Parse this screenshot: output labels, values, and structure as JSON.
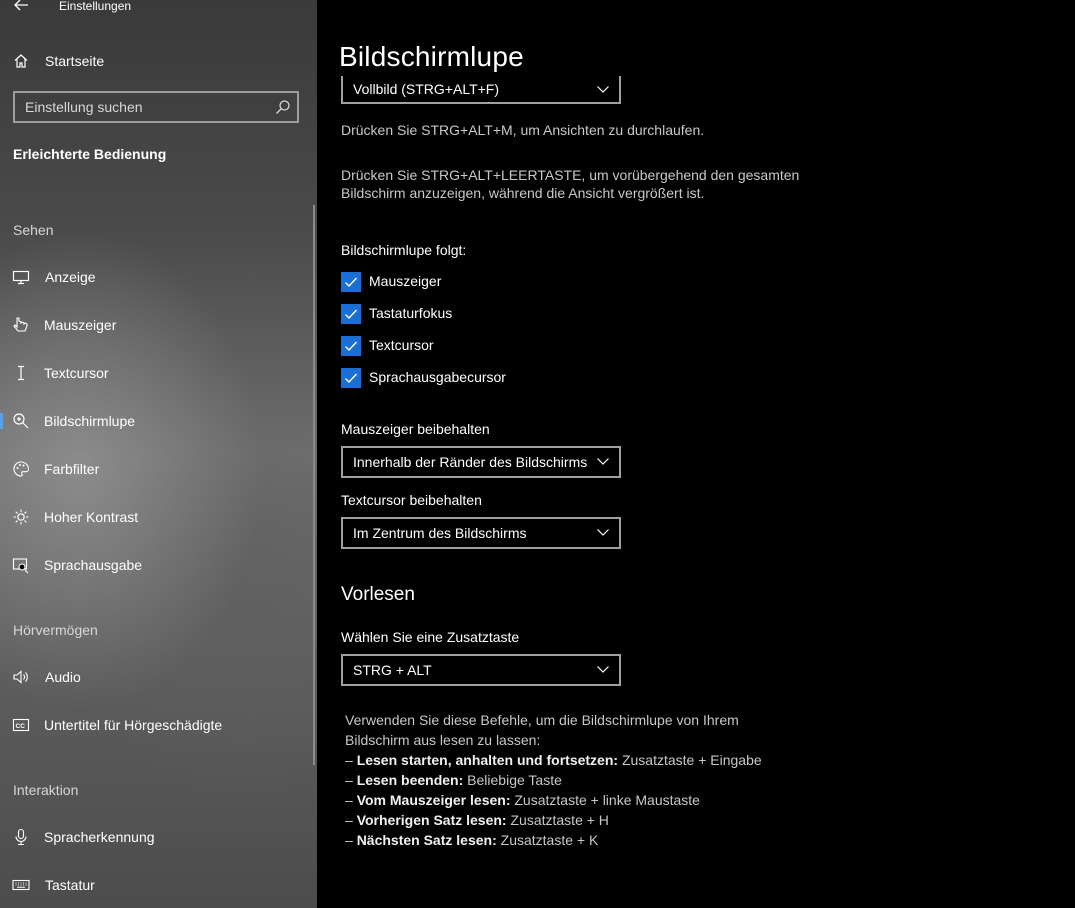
{
  "window": {
    "app_title": "Einstellungen",
    "icons": {
      "back": "back-arrow-icon"
    }
  },
  "sidebar": {
    "home": {
      "label": "Startseite",
      "icon": "home-icon"
    },
    "search": {
      "placeholder": "Einstellung suchen",
      "value": "",
      "icon": "search-icon"
    },
    "group_title": "Erleichterte Bedienung",
    "sections": {
      "sehen": "Sehen",
      "hoeren": "Hörvermögen",
      "interaktion": "Interaktion"
    },
    "items": [
      {
        "id": "anzeige",
        "label": "Anzeige",
        "icon": "display-icon"
      },
      {
        "id": "mauszeiger",
        "label": "Mauszeiger",
        "icon": "mouse-pointer-icon"
      },
      {
        "id": "textcursor",
        "label": "Textcursor",
        "icon": "text-cursor-icon"
      },
      {
        "id": "bildschirmlupe",
        "label": "Bildschirmlupe",
        "icon": "magnifier-icon",
        "active": true
      },
      {
        "id": "farbfilter",
        "label": "Farbfilter",
        "icon": "palette-icon"
      },
      {
        "id": "kontrast",
        "label": "Hoher Kontrast",
        "icon": "sun-icon"
      },
      {
        "id": "sprachausgabe",
        "label": "Sprachausgabe",
        "icon": "narrator-icon"
      },
      {
        "id": "audio",
        "label": "Audio",
        "icon": "speaker-icon"
      },
      {
        "id": "untertitel",
        "label": "Untertitel für Hörgeschädigte",
        "icon": "closed-captions-icon"
      },
      {
        "id": "spracherkennung",
        "label": "Spracherkennung",
        "icon": "microphone-icon"
      },
      {
        "id": "tastatur",
        "label": "Tastatur",
        "icon": "keyboard-icon"
      }
    ],
    "active_color": "#5aa0e6"
  },
  "main": {
    "title": "Bildschirmlupe",
    "view_dropdown": {
      "value": "Vollbild (STRG+ALT+F)"
    },
    "hint_cycle": "Drücken Sie STRG+ALT+M, um Ansichten zu durchlaufen.",
    "hint_full_1": "Drücken Sie STRG+ALT+LEERTASTE, um vorübergehend den gesamten",
    "hint_full_2": "Bildschirm anzuzeigen, während die Ansicht vergrößert ist.",
    "follows_label": "Bildschirmlupe folgt:",
    "follow_options": [
      {
        "label": "Mauszeiger",
        "checked": true
      },
      {
        "label": "Tastaturfokus",
        "checked": true
      },
      {
        "label": "Textcursor",
        "checked": true
      },
      {
        "label": "Sprachausgabecursor",
        "checked": true
      }
    ],
    "mouse_keep": {
      "label": "Mauszeiger beibehalten",
      "value": "Innerhalb der Ränder des Bildschirms"
    },
    "text_keep": {
      "label": "Textcursor beibehalten",
      "value": "Im Zentrum des Bildschirms"
    },
    "readout": {
      "heading": "Vorlesen",
      "modifier_label": "Wählen Sie eine Zusatztaste",
      "modifier_value": "STRG + ALT",
      "intro_1": "Verwenden Sie diese Befehle, um die Bildschirmlupe von Ihrem",
      "intro_2": "Bildschirm aus lesen zu lassen:",
      "commands": [
        {
          "dash": "– ",
          "name": "Lesen starten, anhalten und fortsetzen:",
          "keys": " Zusatztaste + Eingabe"
        },
        {
          "dash": "– ",
          "name": "Lesen beenden:",
          "keys": " Beliebige Taste"
        },
        {
          "dash": "– ",
          "name": "Vom Mauszeiger lesen:",
          "keys": " Zusatztaste + linke Maustaste"
        },
        {
          "dash": "– ",
          "name": "Vorherigen Satz lesen:",
          "keys": " Zusatztaste + H"
        },
        {
          "dash": "– ",
          "name": "Nächsten Satz lesen:",
          "keys": " Zusatztaste + K"
        }
      ]
    },
    "accent_color": "#1a6fd6"
  }
}
